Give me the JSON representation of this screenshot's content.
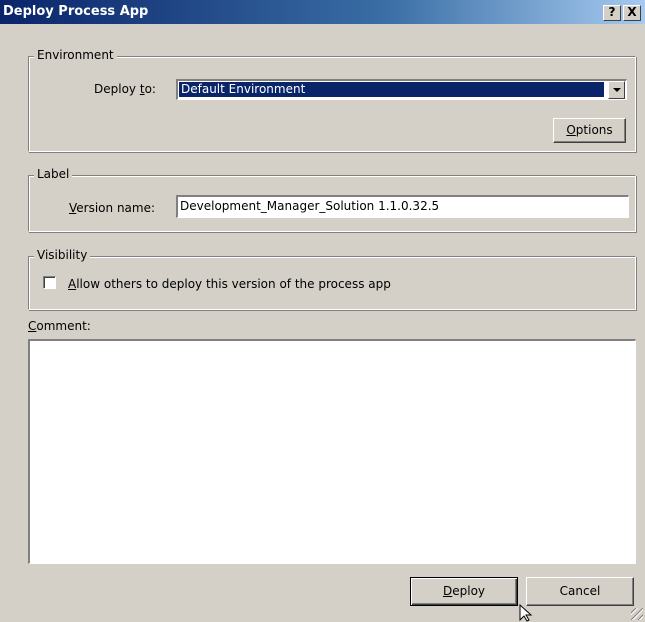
{
  "window": {
    "title": "Deploy Process App",
    "help_label": "?",
    "close_label": "X"
  },
  "environment": {
    "legend": "Environment",
    "deploy_to_label_pre": "Deploy ",
    "deploy_to_label_u": "t",
    "deploy_to_label_post": "o:",
    "deploy_to_value": "Default Environment",
    "options_button_u": "O",
    "options_button_rest": "ptions"
  },
  "label_group": {
    "legend": "Label",
    "version_name_u": "V",
    "version_name_rest": "ersion name:",
    "version_name_value": "Development_Manager_Solution 1.1.0.32.5"
  },
  "visibility": {
    "legend": "Visibility",
    "checkbox_checked": false,
    "checkbox_label_u": "A",
    "checkbox_label_rest": "llow others to deploy this version of the process app"
  },
  "comment": {
    "label_u": "C",
    "label_rest": "omment:",
    "value": ""
  },
  "buttons": {
    "deploy_u": "D",
    "deploy_rest": "eploy",
    "cancel": "Cancel"
  }
}
